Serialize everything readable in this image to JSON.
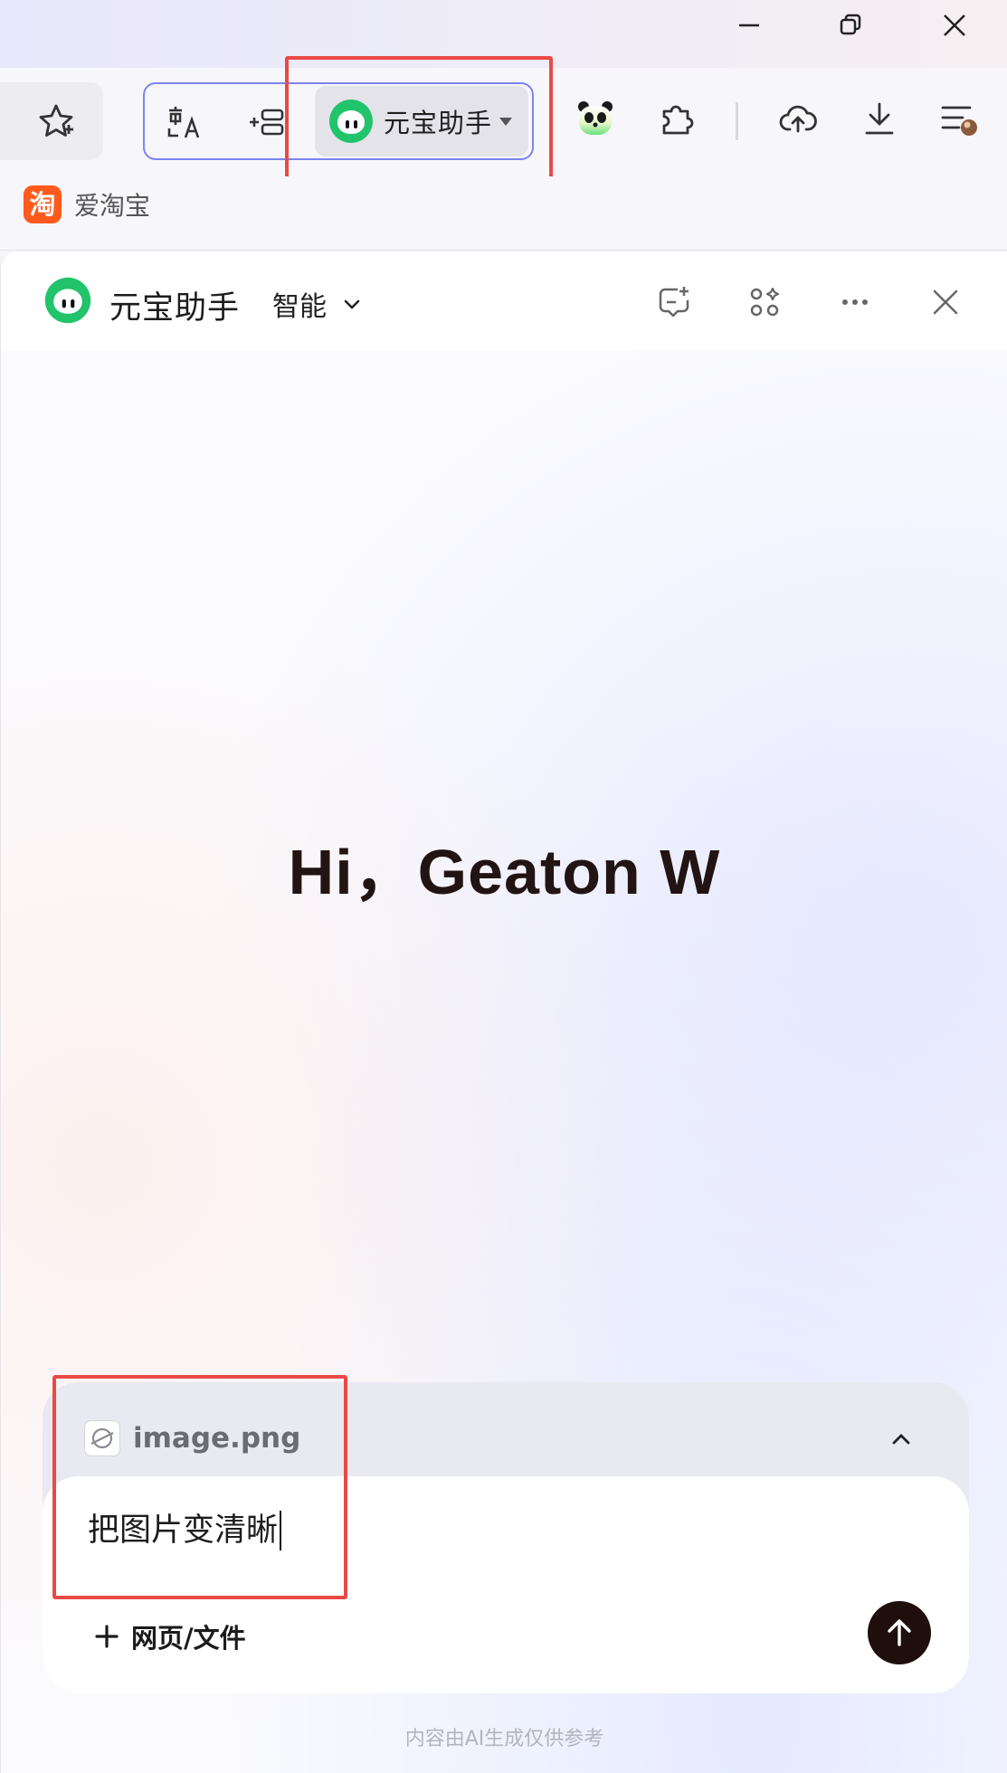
{
  "window": {
    "controls": [
      "minimize",
      "restore",
      "close"
    ]
  },
  "toolbar": {
    "assistant_button": {
      "label": "元宝助手",
      "icon": "yuanbao-logo-icon"
    },
    "icons": [
      "star-icon",
      "translate-icon",
      "add-list-icon",
      "panda-icon",
      "extension-icon",
      "cloud-upload-icon",
      "download-icon",
      "menu-avatar-icon"
    ]
  },
  "bookmarks": [
    {
      "label": "爱淘宝",
      "icon_text": "淘"
    }
  ],
  "panel": {
    "title": "元宝助手",
    "mode": "智能",
    "header_icons": [
      "new-chat-icon",
      "apps-icon",
      "more-icon",
      "close-icon"
    ]
  },
  "greeting": "Hi，Geaton W",
  "composer": {
    "attachment": "image.png",
    "input_value": "把图片变清晰",
    "add_source_label": "网页/文件"
  },
  "disclaimer": "内容由AI生成仅供参考",
  "colors": {
    "brand_green": "#21c46b",
    "highlight_red": "#e94a45",
    "send_button": "#1f0f0c",
    "accent_border": "#7b84f2"
  }
}
